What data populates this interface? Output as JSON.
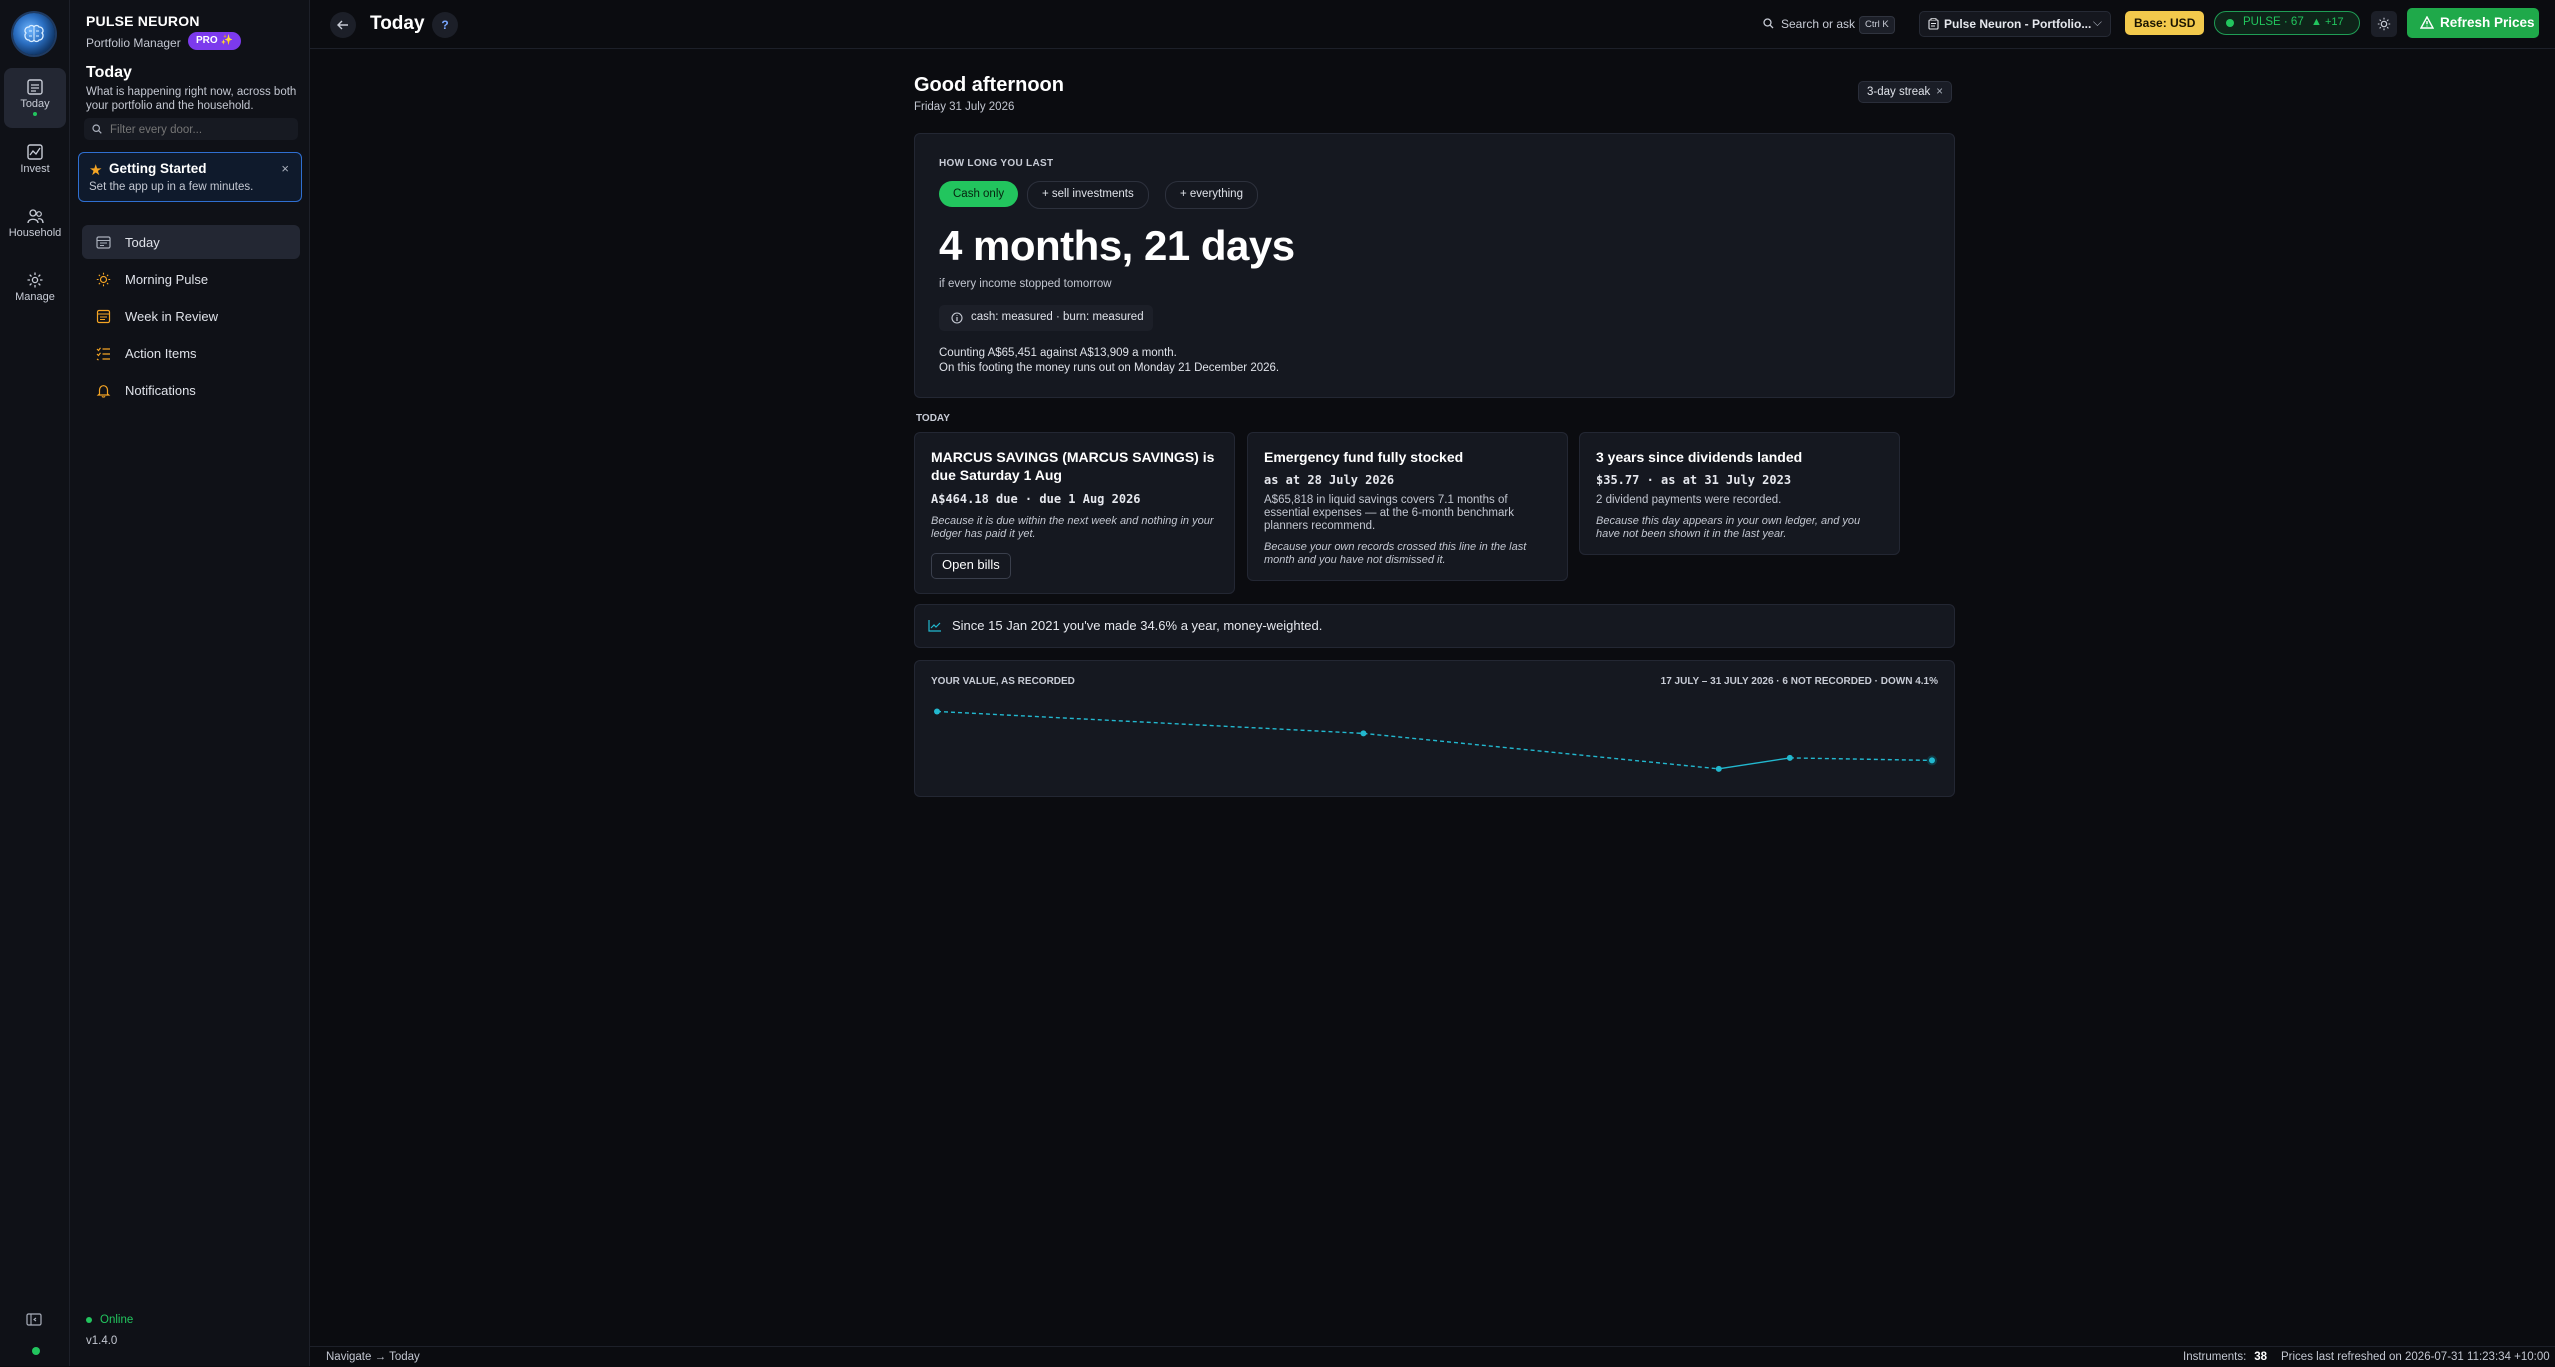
{
  "app": {
    "brand_name": "PULSE NEURON",
    "brand_sub": "Portfolio Manager",
    "pro_badge": "PRO ✨"
  },
  "rail": {
    "items": [
      {
        "label": "Today",
        "icon": "today-icon"
      },
      {
        "label": "Invest",
        "icon": "invest-icon"
      },
      {
        "label": "Household",
        "icon": "household-icon"
      },
      {
        "label": "Manage",
        "icon": "gear-icon"
      }
    ]
  },
  "sidebar": {
    "title": "Today",
    "description": "What is happening right now, across both your portfolio and the household.",
    "filter_placeholder": "Filter every door...",
    "getting_started": {
      "title": "Getting Started",
      "subtitle": "Set the app up in a few minutes.",
      "close": "×"
    },
    "nav": [
      {
        "label": "Today",
        "icon": "calendar-icon"
      },
      {
        "label": "Morning Pulse",
        "icon": "sun-icon"
      },
      {
        "label": "Week in Review",
        "icon": "review-icon"
      },
      {
        "label": "Action Items",
        "icon": "checklist-icon"
      },
      {
        "label": "Notifications",
        "icon": "bell-icon"
      }
    ],
    "status": "Online",
    "version": "v1.4.0"
  },
  "topbar": {
    "title": "Today",
    "help": "?",
    "search_label": "Search or ask",
    "search_kbd": "Ctrl K",
    "portfolio": "Pulse Neuron - Portfolio...",
    "portfolio_caret": "⌵",
    "base": "Base: USD",
    "pulse": "PULSE · 67",
    "pulse_delta": "▲ +17",
    "refresh": "Refresh Prices",
    "colors": {
      "accent": "#22c55e",
      "base_badge": "#f2c94c",
      "pro": "#7c3aed"
    }
  },
  "main": {
    "greeting": "Good afternoon",
    "date": "Friday 31 July 2026",
    "streak": "3-day streak",
    "streak_close": "×",
    "how_long": {
      "label": "HOW LONG YOU LAST",
      "pills": [
        "Cash only",
        "+ sell investments",
        "+ everything"
      ],
      "active_pill": "Cash only",
      "duration": "4 months, 21 days",
      "condition": "if every income stopped tomorrow",
      "measured": "cash: measured · burn: measured",
      "counting": "Counting A$65,451 against A$13,909 a month.",
      "runout": "On this footing the money runs out on Monday 21 December 2026."
    },
    "today_label": "TODAY",
    "cards": [
      {
        "title": "MARCUS SAVINGS (MARCUS SAVINGS) is due Saturday 1 Aug",
        "meta": "A$464.18 due · due 1 Aug 2026",
        "desc": "",
        "reason": "Because it is due within the next week and nothing in your ledger has paid it yet.",
        "action": "Open bills"
      },
      {
        "title": "Emergency fund fully stocked",
        "meta": "as at 28 July 2026",
        "desc": "A$65,818 in liquid savings covers 7.1 months of essential expenses — at the 6-month benchmark planners recommend.",
        "reason": "Because your own records crossed this line in the last month and you have not dismissed it."
      },
      {
        "title": "3 years since dividends landed",
        "meta": "$35.77 · as at 31 July 2023",
        "desc": "2 dividend payments were recorded.",
        "reason": "Because this day appears in your own ledger, and you have not been shown it in the last year."
      }
    ],
    "money_weighted": "Since 15 Jan 2021 you've made 34.6% a year, money-weighted."
  },
  "chart_data": {
    "type": "line",
    "title": "YOUR VALUE, AS RECORDED",
    "subtitle": "17 JULY – 31 JULY 2026 · 6 NOT RECORDED · DOWN 4.1%",
    "x": [
      "2026-07-17",
      "2026-07-23",
      "2026-07-28",
      "2026-07-29",
      "2026-07-31"
    ],
    "values": [
      100,
      97.4,
      93.2,
      94.5,
      94.2
    ],
    "recorded": [
      true,
      true,
      true,
      true,
      true
    ],
    "ylim": [
      92,
      101
    ],
    "grid": false,
    "legend": "none",
    "color": "#22b8cf"
  },
  "statusbar": {
    "nav": "Navigate → Today",
    "instruments_label": "Instruments:",
    "instruments_count": "38",
    "prices": "Prices last refreshed on 2026-07-31 11:23:34 +10:00"
  }
}
